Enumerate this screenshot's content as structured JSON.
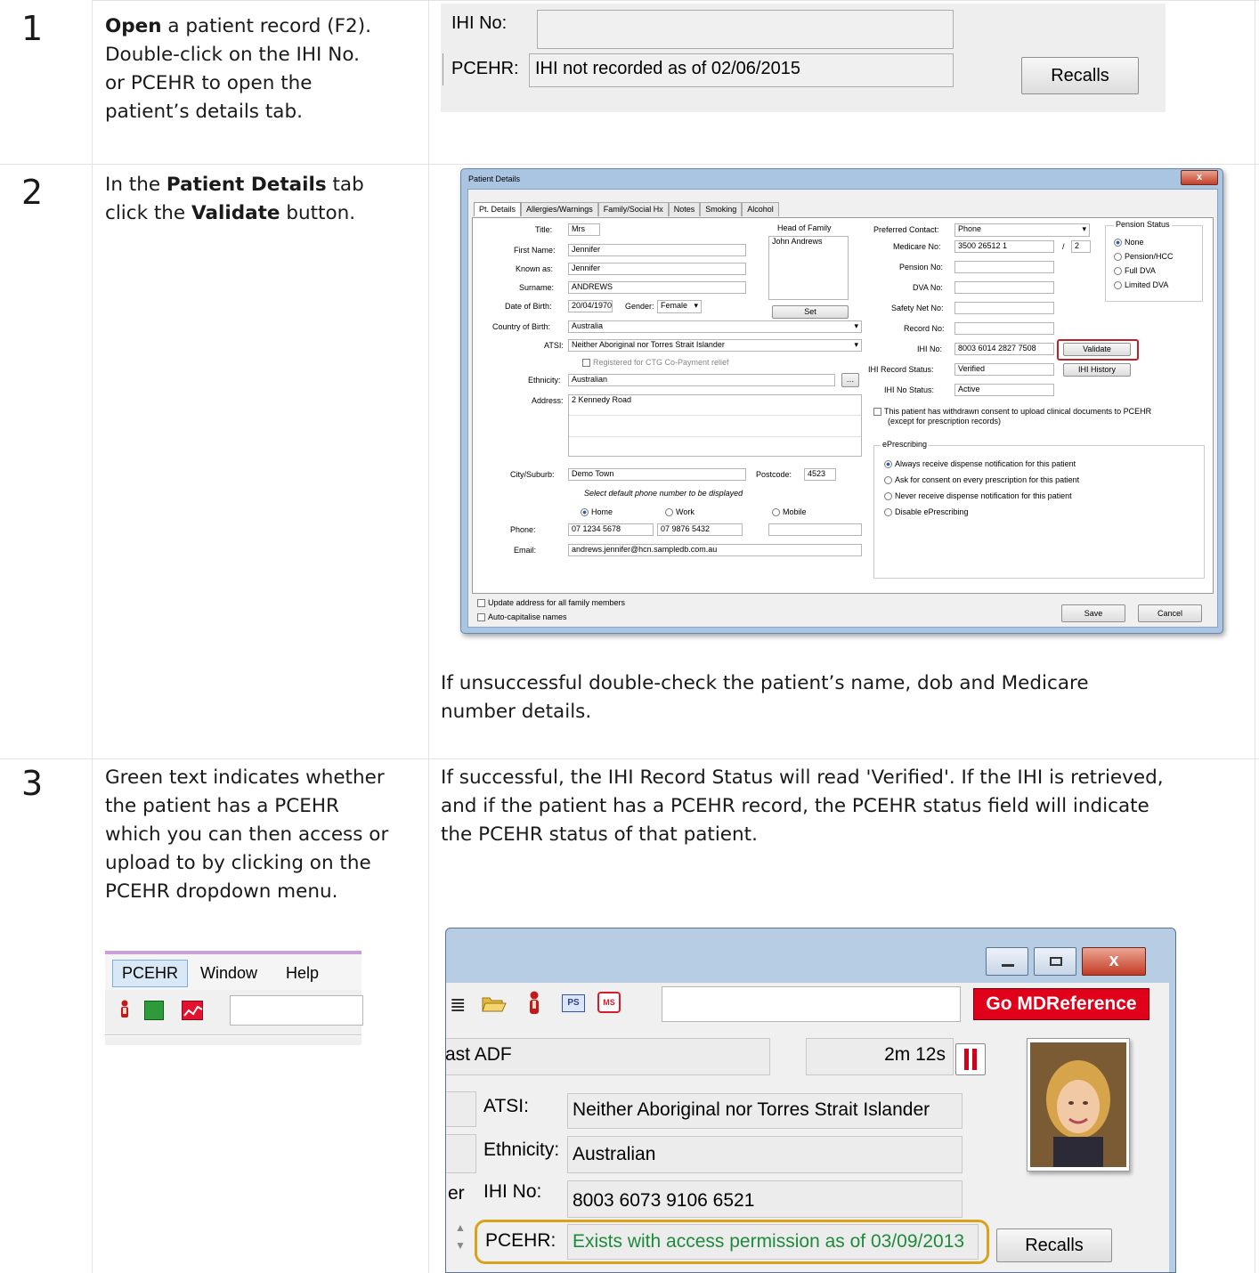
{
  "rows": [
    {
      "number": "1",
      "instructions": {
        "bold_open": "Open",
        "line1_rest": " a patient record (F2).",
        "line2": "Double-click on the IHI No.",
        "line3": "or PCEHR to open the",
        "line4": "patient’s details tab."
      }
    },
    {
      "number": "2",
      "instructions": {
        "line1_pre": "In the ",
        "line1_bold": "Patient Details",
        "line1_post": " tab",
        "line2_pre": "click the ",
        "line2_bold": "Validate",
        "line2_post": " button."
      },
      "note_line1": "If unsuccessful double-check the patient’s name, dob and Medicare",
      "note_line2": "number details."
    },
    {
      "number": "3",
      "instructions": {
        "line1": "Green text indicates whether",
        "line2": "the patient has a PCEHR",
        "line3": "which you can then access or",
        "line4": "upload to by clicking on the",
        "line5": "PCEHR dropdown menu."
      },
      "description_line1": "If successful, the IHI Record Status will read 'Verified'. If the IHI is retrieved,",
      "description_line2": "and if the patient has a PCEHR record, the PCEHR status field will indicate",
      "description_line3": "the PCEHR status of that patient."
    }
  ],
  "shot1": {
    "ihi_label": "IHI No:",
    "ihi_value": "",
    "pcehr_label": "PCEHR:",
    "pcehr_value": "IHI not recorded as of 02/06/2015",
    "recalls_button": "Recalls"
  },
  "dialog": {
    "title": "Patient Details",
    "close_glyph": "x",
    "tabs": [
      "Pt. Details",
      "Allergies/Warnings",
      "Family/Social Hx",
      "Notes",
      "Smoking",
      "Alcohol"
    ],
    "title_label": "Title:",
    "title_value": "Mrs",
    "first_name_label": "First Name:",
    "first_name_value": "Jennifer",
    "known_as_label": "Known as:",
    "known_as_value": "Jennifer",
    "surname_label": "Surname:",
    "surname_value": "ANDREWS",
    "dob_label": "Date of Birth:",
    "dob_value": "20/04/1970",
    "gender_label": "Gender:",
    "gender_value": "Female",
    "country_label": "Country of Birth:",
    "country_value": "Australia",
    "atsi_label": "ATSI:",
    "atsi_value": "Neither Aboriginal nor Torres Strait Islander",
    "ctg_label": "Registered for CTG Co-Payment relief",
    "ethnicity_label": "Ethnicity:",
    "ethnicity_value": "Australian",
    "address_label": "Address:",
    "address_value": "2 Kennedy Road",
    "city_label": "City/Suburb:",
    "city_value": "Demo Town",
    "postcode_label": "Postcode:",
    "postcode_value": "4523",
    "phone_hint": "Select default phone number to be displayed",
    "home_label": "Home",
    "work_label": "Work",
    "mobile_label": "Mobile",
    "phone_label": "Phone:",
    "home_phone": "07 1234 5678",
    "work_phone": "07 9876 5432",
    "email_label": "Email:",
    "email_value": "andrews.jennifer@hcn.sampledb.com.au",
    "head_of_family_label": "Head of Family",
    "head_of_family_value": "John Andrews",
    "set_button": "Set",
    "preferred_contact_label": "Preferred Contact:",
    "preferred_contact_value": "Phone",
    "medicare_label": "Medicare No:",
    "medicare_value": "3500 26512 1",
    "medicare_irn": "2",
    "pension_label": "Pension No:",
    "dva_label": "DVA No:",
    "safety_net_label": "Safety Net No:",
    "record_no_label": "Record No:",
    "ihi_label": "IHI No:",
    "ihi_value": "8003 6014 2827 7508",
    "validate_button": "Validate",
    "ihi_record_status_label": "IHI Record Status:",
    "ihi_record_status_value": "Verified",
    "ihi_history_button": "IHI History",
    "ihi_no_status_label": "IHI No Status:",
    "ihi_no_status_value": "Active",
    "pension_status_title": "Pension Status",
    "pension_options": [
      "None",
      "Pension/HCC",
      "Full DVA",
      "Limited DVA"
    ],
    "consent_line1": "This patient has withdrawn consent to upload clinical documents to PCEHR",
    "consent_line2": "(except for prescription records)",
    "eprescribing_title": "ePrescribing",
    "eprescribing_options": [
      "Always receive dispense notification for this patient",
      "Ask for consent on every prescription for this patient",
      "Never receive dispense notification for this patient",
      "Disable ePrescribing"
    ],
    "update_address_label": "Update address for all family members",
    "auto_capitalise_label": "Auto-capitalise names",
    "save_button": "Save",
    "cancel_button": "Cancel"
  },
  "menu_shot": {
    "menu_items": [
      "PCEHR",
      "Window",
      "Help"
    ]
  },
  "shot3": {
    "go_button": "Go MDReference",
    "partial_label": "ast ADF",
    "timer": "2m 12s",
    "atsi_label": "ATSI:",
    "atsi_value": "Neither Aboriginal nor Torres Strait Islander",
    "ethnicity_label": "Ethnicity:",
    "ethnicity_value": "Australian",
    "er_fragment": "er",
    "ihi_label": "IHI No:",
    "ihi_value": "8003 6073 9106 6521",
    "pcehr_label": "PCEHR:",
    "pcehr_value": "Exists with access permission as of 03/09/2013",
    "recalls_button": "Recalls"
  },
  "colors": {
    "pcehr_green": "#1e8a3c",
    "highlight_red": "#c0202a",
    "highlight_orange": "#d9a21b",
    "go_red": "#e0001a"
  }
}
